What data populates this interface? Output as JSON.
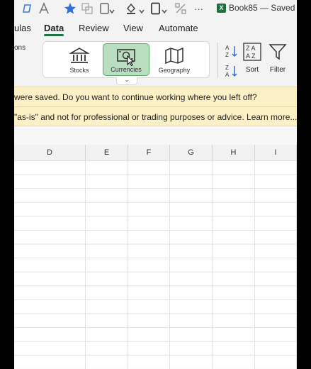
{
  "title_bar": {
    "badge": "X",
    "workbook": "Book85 — Saved",
    "more": "···"
  },
  "tabs": [
    {
      "label": "ulas",
      "active": false
    },
    {
      "label": "Data",
      "active": true
    },
    {
      "label": "Review",
      "active": false
    },
    {
      "label": "View",
      "active": false
    },
    {
      "label": "Automate",
      "active": false
    }
  ],
  "ribbon": {
    "truncated_label": "ons",
    "data_types": [
      {
        "label": "Stocks",
        "icon": "bank-icon",
        "selected": false
      },
      {
        "label": "Currencies",
        "icon": "currency-icon",
        "selected": true
      },
      {
        "label": "Geography",
        "icon": "map-icon",
        "selected": false
      }
    ],
    "expander_glyph": "⌄",
    "sort_label": "Sort",
    "filter_label": "Filter"
  },
  "infobar": {
    "line1": "were saved. Do you want to continue working where you left off?",
    "line2": "\"as-is\" and not for professional or trading purposes or advice. Learn more..."
  },
  "columns": [
    "D",
    "E",
    "F",
    "G",
    "H",
    "I"
  ],
  "accent_color": "#217346"
}
